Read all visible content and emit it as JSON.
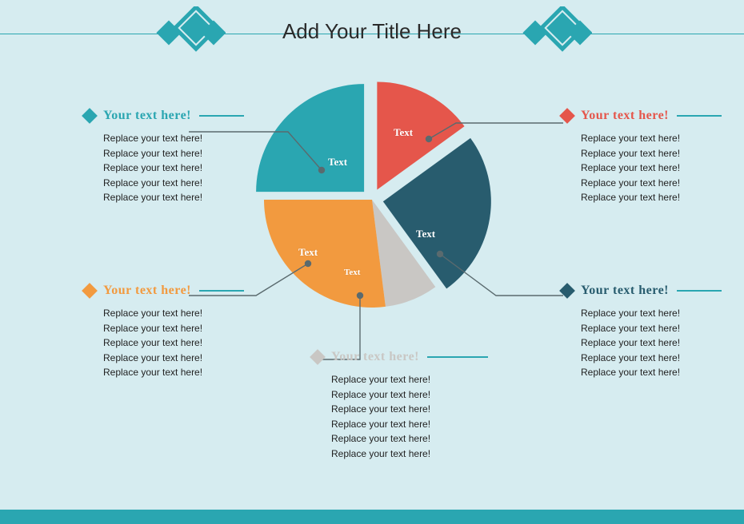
{
  "title": "Add Your Title Here",
  "chart_data": {
    "type": "pie",
    "title": "Add Your Title Here",
    "series": [
      {
        "name": "Text",
        "value": 15,
        "color": "#e5564b",
        "exploded": true
      },
      {
        "name": "Text",
        "value": 25,
        "color": "#285c6e",
        "exploded": true
      },
      {
        "name": "Text",
        "value": 8,
        "color": "#c9c7c4",
        "exploded": false
      },
      {
        "name": "Text",
        "value": 27,
        "color": "#f29a3f",
        "exploded": false
      },
      {
        "name": "Text",
        "value": 25,
        "color": "#2aa6b1",
        "exploded": true
      }
    ],
    "total": 100
  },
  "callouts": [
    {
      "id": "teal",
      "heading": "Your text here!",
      "color": "#2aa6b1",
      "lines": [
        "Replace your text here!",
        "Replace your text here!",
        "Replace your text here!",
        "Replace your text here!",
        "Replace your text here!"
      ]
    },
    {
      "id": "red",
      "heading": "Your text here!",
      "color": "#e5564b",
      "lines": [
        "Replace your text here!",
        "Replace your text here!",
        "Replace your text here!",
        "Replace your text here!",
        "Replace your text here!"
      ]
    },
    {
      "id": "orange",
      "heading": "Your text here!",
      "color": "#f29a3f",
      "lines": [
        "Replace your text here!",
        "Replace your text here!",
        "Replace your text here!",
        "Replace your text here!",
        "Replace your text here!"
      ]
    },
    {
      "id": "dark",
      "heading": "Your text here!",
      "color": "#285c6e",
      "lines": [
        "Replace your text here!",
        "Replace your text here!",
        "Replace your text here!",
        "Replace your text here!",
        "Replace your text here!"
      ]
    },
    {
      "id": "grey",
      "heading": "Your text here!",
      "color": "#c9c7c4",
      "lines": [
        "Replace your text here!",
        "Replace your text here!",
        "Replace your text here!",
        "Replace your text here!",
        "Replace your text here!",
        "Replace your text here!"
      ]
    }
  ],
  "slice_labels": {
    "teal": "Text",
    "red": "Text",
    "orange": "Text",
    "dark": "Text",
    "grey": "Text"
  }
}
